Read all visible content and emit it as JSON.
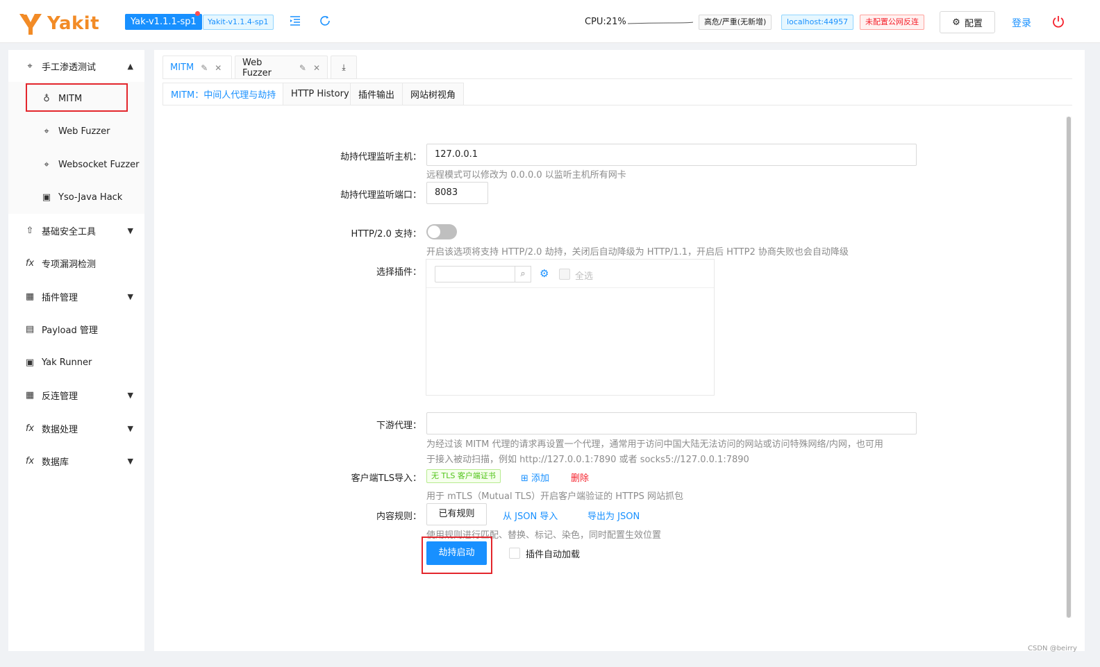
{
  "app": {
    "name": "Yakit",
    "version_main": "Yak-v1.1.1-sp1",
    "version_sub": "Yakit-v1.1.4-sp1",
    "cpu": "CPU:21%",
    "risk_tag": "高危/严重(无新增)",
    "host_tag": "localhost:44957",
    "reverse_tag": "未配置公网反连",
    "config_label": "配置",
    "login_label": "登录"
  },
  "sidebar": {
    "items": [
      {
        "label": "手工渗透测试",
        "icon": "crosshair-icon"
      },
      {
        "label": "MITM",
        "icon": "fire-icon"
      },
      {
        "label": "Web Fuzzer",
        "icon": "crosshair-icon"
      },
      {
        "label": "Websocket Fuzzer",
        "icon": "crosshair-icon"
      },
      {
        "label": "Yso-Java Hack",
        "icon": "terminal-icon"
      },
      {
        "label": "基础安全工具",
        "icon": "rocket-icon"
      },
      {
        "label": "专项漏洞检测",
        "icon": "fx-icon"
      },
      {
        "label": "插件管理",
        "icon": "grid-icon"
      },
      {
        "label": "Payload 管理",
        "icon": "file-icon"
      },
      {
        "label": "Yak Runner",
        "icon": "terminal-icon"
      },
      {
        "label": "反连管理",
        "icon": "grid-icon"
      },
      {
        "label": "数据处理",
        "icon": "fx-icon"
      },
      {
        "label": "数据库",
        "icon": "fx-icon"
      }
    ]
  },
  "tabs": {
    "top": [
      {
        "label": "MITM"
      },
      {
        "label": "Web Fuzzer"
      }
    ],
    "sub": [
      {
        "label": "MITM：中间人代理与劫持"
      },
      {
        "label": "HTTP History"
      },
      {
        "label": "插件输出"
      },
      {
        "label": "网站树视角"
      }
    ]
  },
  "form": {
    "host_label": "劫持代理监听主机：",
    "host_value": "127.0.0.1",
    "host_help": "远程模式可以修改为 0.0.0.0 以监听主机所有网卡",
    "port_label": "劫持代理监听端口：",
    "port_value": "8083",
    "http2_label": "HTTP/2.0 支持：",
    "http2_help": "开启该选项将支持 HTTP/2.0 劫持，关闭后自动降级为 HTTP/1.1，开启后 HTTP2 协商失败也会自动降级",
    "http2_enabled": false,
    "plugin_label": "选择插件：",
    "plugin_select_all": "全选",
    "proxy_label": "下游代理：",
    "proxy_help_1": "为经过该 MITM 代理的请求再设置一个代理，通常用于访问中国大陆无法访问的网站或访问特殊网络/内网，也可用",
    "proxy_help_2": "于接入被动扫描，例如 http://127.0.0.1:7890 或者 socks5://127.0.0.1:7890",
    "tls_label": "客户端TLS导入：",
    "tls_tag": "无 TLS 客户端证书",
    "tls_add": "添加",
    "tls_delete": "删除",
    "tls_help": "用于 mTLS（Mutual TLS）开启客户端验证的 HTTPS 网站抓包",
    "rules_label": "内容规则：",
    "rules_existing": "已有规则",
    "rules_import": "从 JSON 导入",
    "rules_export": "导出为 JSON",
    "rules_help": "使用规则进行匹配、替换、标记、染色，同时配置生效位置",
    "start_button": "劫持启动",
    "auto_load_label": "插件自动加载"
  },
  "watermark": "CSDN @beirry"
}
